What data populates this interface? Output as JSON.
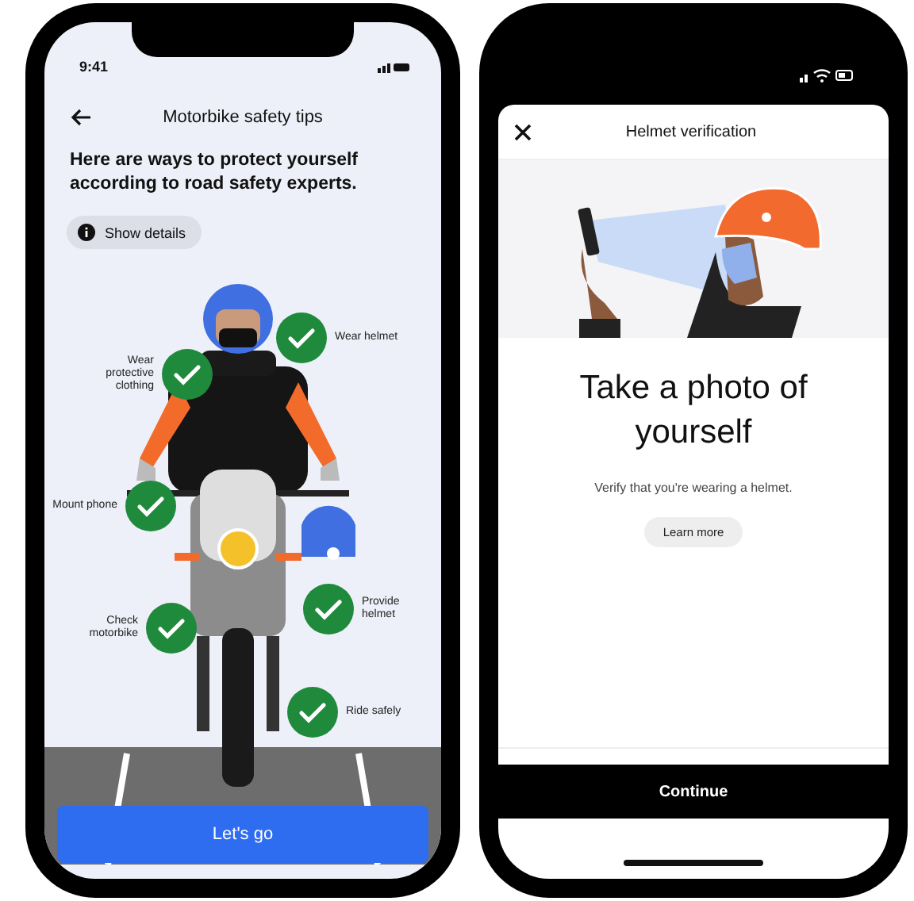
{
  "safety_screen": {
    "status_time": "9:41",
    "title": "Motorbike safety tips",
    "intro": "Here are ways to protect yourself according to road safety experts.",
    "details_chip": "Show details",
    "tips": [
      "Wear helmet",
      "Wear protective clothing",
      "Mount phone",
      "Provide helmet",
      "Check motorbike",
      "Ride safely"
    ],
    "primary_button": "Let's go"
  },
  "verification_screen": {
    "title": "Helmet verification",
    "heading": "Take a photo of yourself",
    "description": "Verify that you're wearing a helmet.",
    "learn_more": "Learn more",
    "primary_button": "Continue"
  }
}
